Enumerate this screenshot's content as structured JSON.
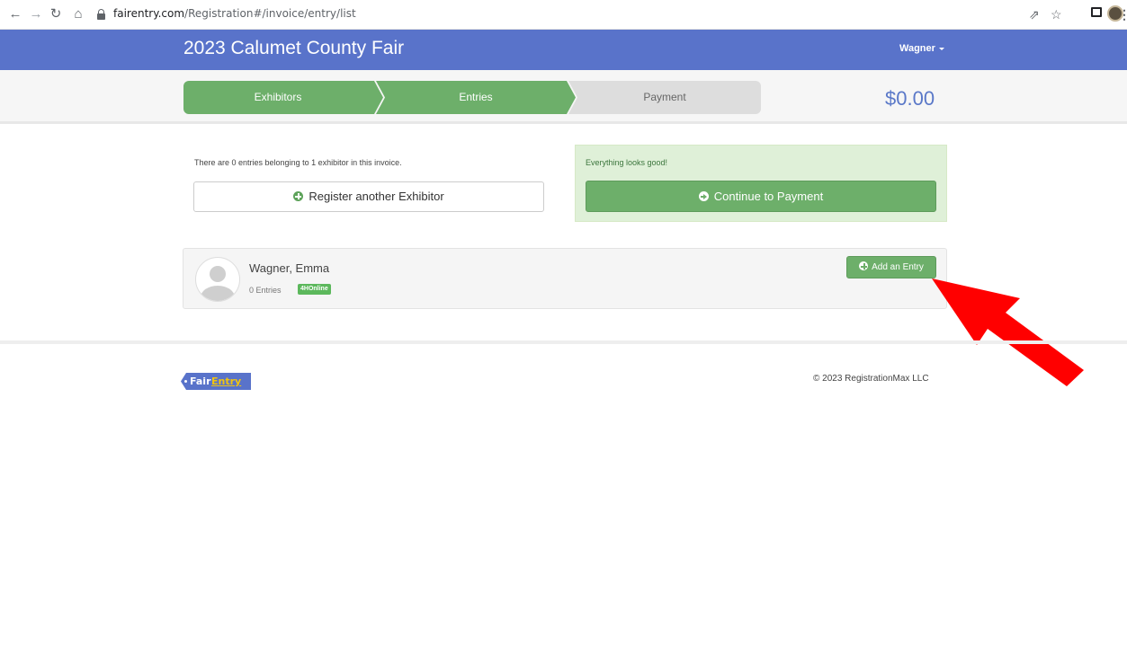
{
  "browser": {
    "url_host": "fairentry.com",
    "url_path": "/Registration#/invoice/entry/list"
  },
  "header": {
    "title": "2023 Calumet County Fair",
    "user": "Wagner"
  },
  "steps": [
    {
      "label": "Exhibitors",
      "state": "done"
    },
    {
      "label": "Entries",
      "state": "done"
    },
    {
      "label": "Payment",
      "state": "todo"
    }
  ],
  "total": "$0.00",
  "summary": {
    "text": "There are 0 entries belonging to 1 exhibitor in this invoice.",
    "register_button": "Register another Exhibitor"
  },
  "status_panel": {
    "text": "Everything looks good!",
    "continue_button": "Continue to Payment"
  },
  "exhibitors": [
    {
      "name": "Wagner, Emma",
      "entries": "0 Entries",
      "badge": "4HOnline",
      "add_button": "Add an Entry"
    }
  ],
  "footer": {
    "logo_fair": "Fair",
    "logo_entry": "Entry",
    "copyright": "© 2023 RegistrationMax LLC"
  },
  "colors": {
    "header": "#5973ca",
    "success": "#6daf6a",
    "total": "#5a78c8",
    "annotation": "#ff0000"
  }
}
